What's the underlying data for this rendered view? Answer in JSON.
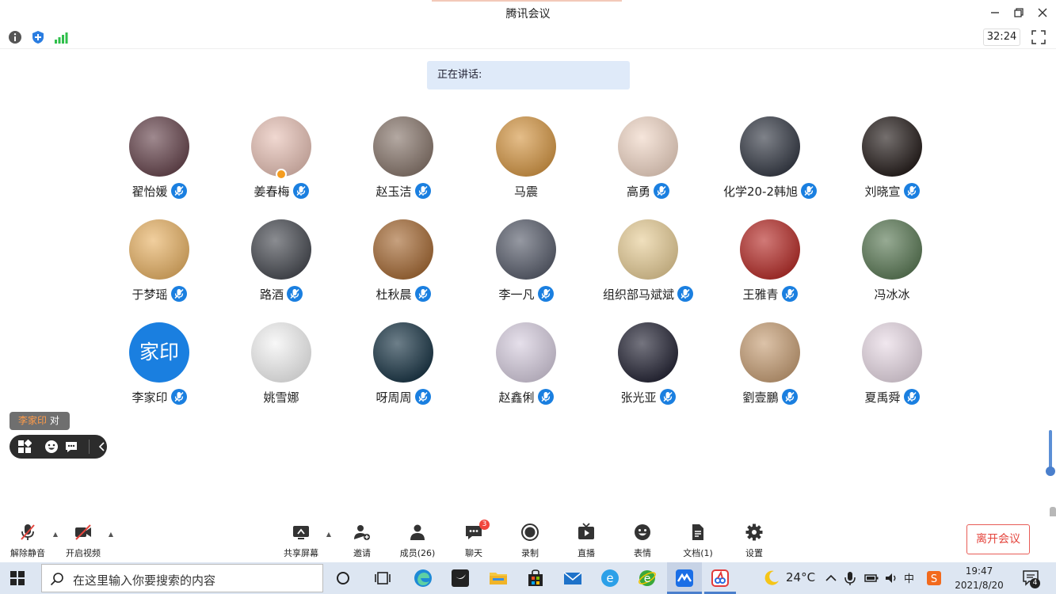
{
  "window": {
    "title": "腾讯会议",
    "minimize_icon": "minimize-icon",
    "restore_icon": "restore-icon",
    "close_icon": "close-icon"
  },
  "infobar": {
    "icons": [
      "info-icon",
      "shield-icon",
      "signal-icon"
    ],
    "timer": "32:24",
    "fullscreen_icon": "fullscreen-icon"
  },
  "speaking": {
    "label": "正在讲话:"
  },
  "participants": [
    {
      "name": "翟怡媛",
      "muted": true,
      "avatar_color": "#6b4a52"
    },
    {
      "name": "姜春梅",
      "muted": true,
      "host": true,
      "avatar_color": "#e8c3b8"
    },
    {
      "name": "赵玉洁",
      "muted": true,
      "avatar_color": "#8b7a70"
    },
    {
      "name": "马震",
      "muted": false,
      "avatar_color": "#d69a4a"
    },
    {
      "name": "高勇",
      "muted": true,
      "avatar_color": "#f1d8c8"
    },
    {
      "name": "化学20-2韩旭",
      "muted": true,
      "avatar_color": "#3a3f4a"
    },
    {
      "name": "刘晓宣",
      "muted": true,
      "avatar_color": "#2a2220"
    },
    {
      "name": "于梦瑶",
      "muted": true,
      "avatar_color": "#e9b56a"
    },
    {
      "name": "路酒",
      "muted": true,
      "avatar_color": "#4c4f56"
    },
    {
      "name": "杜秋晨",
      "muted": true,
      "avatar_color": "#a86e3a"
    },
    {
      "name": "李一凡",
      "muted": true,
      "avatar_color": "#5d6270"
    },
    {
      "name": "组织部马斌斌",
      "muted": true,
      "avatar_color": "#e8cf9a"
    },
    {
      "name": "王雅青",
      "muted": true,
      "avatar_color": "#b8322e"
    },
    {
      "name": "冯冰冰",
      "muted": false,
      "avatar_color": "#5f7d5a"
    },
    {
      "name": "李家印",
      "muted": true,
      "avatar_color": "#1a7fe0",
      "avatar_text": "家印"
    },
    {
      "name": "姚雪娜",
      "muted": false,
      "avatar_color": "#f4f4f4"
    },
    {
      "name": "呀周周",
      "muted": true,
      "avatar_color": "#1f3a4a"
    },
    {
      "name": "赵鑫俐",
      "muted": true,
      "avatar_color": "#d8cfe0"
    },
    {
      "name": "张光亚",
      "muted": true,
      "avatar_color": "#2a2a3a"
    },
    {
      "name": "劉壹鵬",
      "muted": true,
      "avatar_color": "#c9a27a"
    },
    {
      "name": "夏禹舜",
      "muted": true,
      "avatar_color": "#e9dbe6"
    }
  ],
  "reaction": {
    "who": "李家印",
    "text": "对"
  },
  "reaction_bar": {
    "icons": [
      "layout-icon",
      "emoji-icon",
      "chat-icon",
      "collapse-icon"
    ]
  },
  "toolbar": {
    "buttons": [
      {
        "label": "解除静音",
        "icon": "mic-muted-icon"
      },
      {
        "label": "开启视频",
        "icon": "video-off-icon"
      },
      {
        "label": "共享屏幕",
        "icon": "share-screen-icon"
      },
      {
        "label": "邀请",
        "icon": "invite-icon"
      },
      {
        "label": "成员(26)",
        "icon": "members-icon"
      },
      {
        "label": "聊天",
        "icon": "chat-icon",
        "badge": "3"
      },
      {
        "label": "录制",
        "icon": "record-icon"
      },
      {
        "label": "直播",
        "icon": "live-icon"
      },
      {
        "label": "表情",
        "icon": "emoji-icon"
      },
      {
        "label": "文档(1)",
        "icon": "document-icon"
      },
      {
        "label": "设置",
        "icon": "settings-icon"
      }
    ],
    "leave": "离开会议"
  },
  "taskbar": {
    "search_placeholder": "在这里输入你要搜索的内容",
    "weather": "24°C",
    "ime": "中",
    "time": "19:47",
    "date": "2021/8/20",
    "notifications": "4",
    "apps": [
      "cortana-icon",
      "task-view-icon",
      "edge-icon",
      "feishu-icon",
      "file-explorer-icon",
      "store-icon",
      "mail-icon",
      "ie-icon",
      "ie-alt-icon",
      "tencent-meeting-icon",
      "wps-icon"
    ]
  },
  "colors": {
    "accent": "#1a7fe0",
    "leave": "#e4453d",
    "taskbar": "#dde6f2",
    "speaking": "#dfeaf9"
  }
}
